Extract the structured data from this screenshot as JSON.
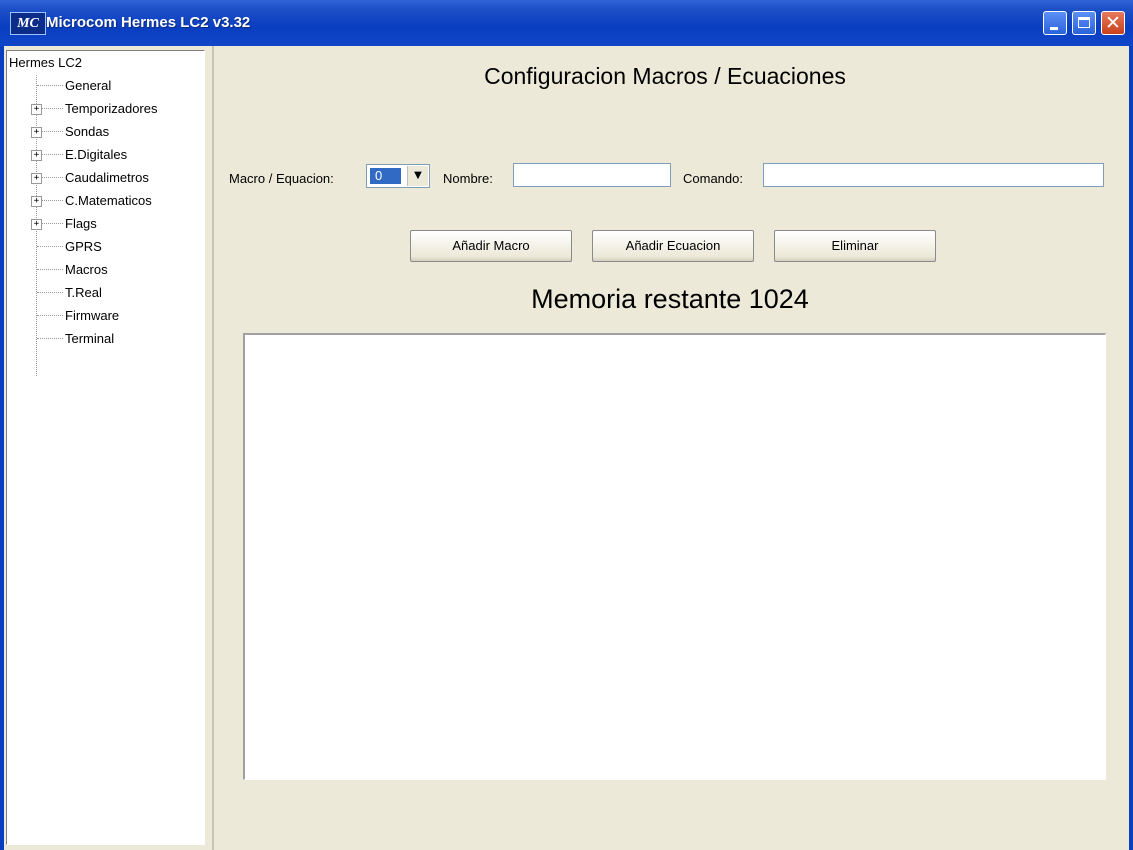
{
  "window": {
    "title": "Microcom Hermes LC2 v3.32",
    "app_icon_text": "MC",
    "close_glyph": "✕"
  },
  "tree": {
    "root": "Hermes LC2",
    "items": [
      {
        "label": "General",
        "expandable": false
      },
      {
        "label": "Temporizadores",
        "expandable": true
      },
      {
        "label": "Sondas",
        "expandable": true
      },
      {
        "label": "E.Digitales",
        "expandable": true
      },
      {
        "label": "Caudalimetros",
        "expandable": true
      },
      {
        "label": "C.Matematicos",
        "expandable": true
      },
      {
        "label": "Flags",
        "expandable": true
      },
      {
        "label": "GPRS",
        "expandable": false
      },
      {
        "label": "Macros",
        "expandable": false
      },
      {
        "label": "T.Real",
        "expandable": false
      },
      {
        "label": "Firmware",
        "expandable": false
      },
      {
        "label": "Terminal",
        "expandable": false
      }
    ],
    "expander_glyph": "+"
  },
  "panel": {
    "title": "Configuracion Macros / Ecuaciones",
    "macro_label": "Macro / Equacion:",
    "macro_value": "0",
    "combo_arrow": "▼",
    "nombre_label": "Nombre:",
    "nombre_value": "",
    "comando_label": "Comando:",
    "comando_value": "",
    "buttons": {
      "add_macro": "Añadir Macro",
      "add_equation": "Añadir Ecuacion",
      "delete": "Eliminar"
    },
    "memoria": "Memoria restante 1024"
  }
}
